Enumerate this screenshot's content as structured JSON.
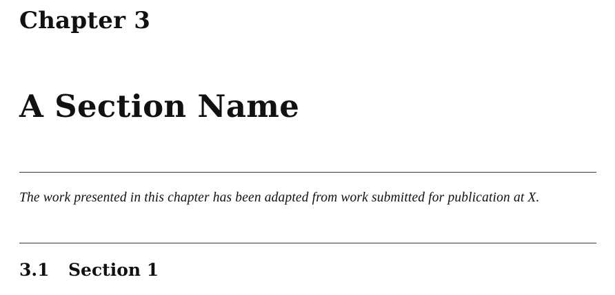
{
  "chapter": {
    "label": "Chapter 3",
    "title": "A Section Name"
  },
  "publication_note": {
    "text": "The work presented in this chapter has been adapted from work submitted for publication at X."
  },
  "section": {
    "number": "3.1",
    "title": "Section 1"
  }
}
